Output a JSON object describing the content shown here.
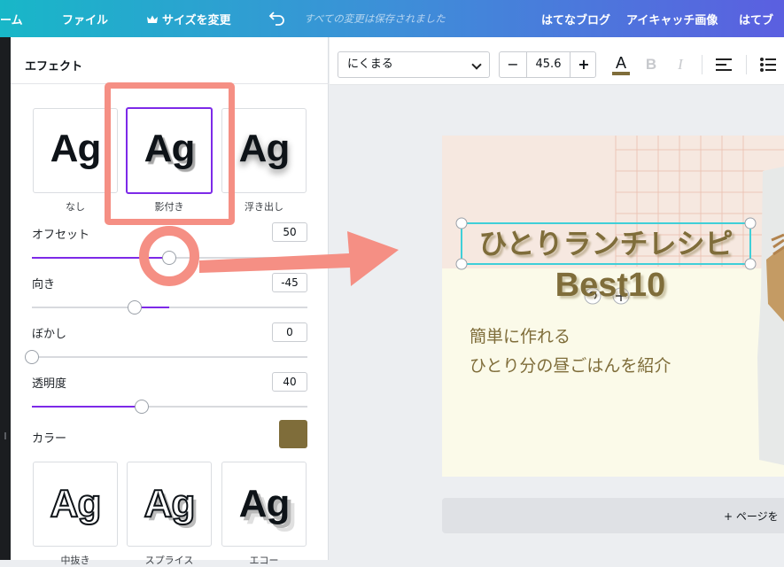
{
  "topbar": {
    "home": "ーム",
    "file": "ファイル",
    "resize": "サイズを変更",
    "saved": "すべての変更は保存されました",
    "doc_links": [
      "はてなブログ",
      "アイキャッチ画像",
      "はてブ"
    ]
  },
  "effects_panel": {
    "title": "エフェクト",
    "effect_cards": [
      {
        "sample": "Ag",
        "label": "なし"
      },
      {
        "sample": "Ag",
        "label": "影付き"
      },
      {
        "sample": "Ag",
        "label": "浮き出し"
      }
    ],
    "selected_effect": "影付き",
    "controls": [
      {
        "label": "オフセット",
        "value": "50",
        "level": 0.5
      },
      {
        "label": "向き",
        "value": "-45",
        "level": 0.375
      },
      {
        "label": "ぼかし",
        "value": "0",
        "level": 0.0
      },
      {
        "label": "透明度",
        "value": "40",
        "level": 0.4
      }
    ],
    "color_label": "カラー",
    "color_value": "#7f6d3a",
    "more_cards": [
      {
        "sample": "Ag",
        "label": "中抜き"
      },
      {
        "sample": "Ag",
        "label": "スプライス"
      },
      {
        "sample": "Ag",
        "label": "エコー"
      }
    ]
  },
  "toolbar": {
    "font": "にくまる",
    "font_size": "45.6",
    "minus": "−",
    "plus": "+",
    "text_color_glyph": "A",
    "bold_glyph": "B",
    "italic_glyph": "I"
  },
  "design": {
    "title": "ひとりランチレシピ",
    "subtitle": "Best10",
    "line1": "簡単に作れる",
    "line2": "ひとり分の昼ごはんを紹介",
    "text_color": "#7f6d3a"
  },
  "add_page": "+ ページを"
}
